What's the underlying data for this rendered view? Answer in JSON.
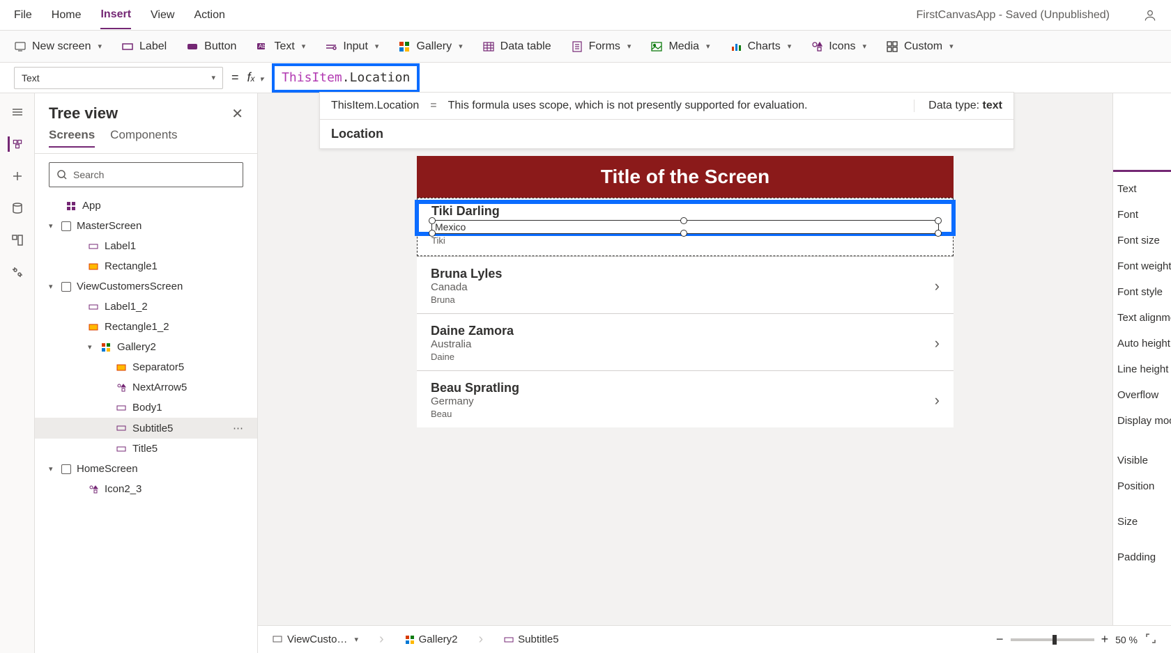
{
  "app": {
    "title": "FirstCanvasApp - Saved (Unpublished)"
  },
  "menubar": {
    "file": "File",
    "home": "Home",
    "insert": "Insert",
    "view": "View",
    "action": "Action"
  },
  "ribbon": {
    "new_screen": "New screen",
    "label": "Label",
    "button": "Button",
    "text": "Text",
    "input": "Input",
    "gallery": "Gallery",
    "data_table": "Data table",
    "forms": "Forms",
    "media": "Media",
    "charts": "Charts",
    "icons": "Icons",
    "custom": "Custom"
  },
  "formula": {
    "prop_selector": "Text",
    "ident": "ThisItem",
    "member": ".Location",
    "info_left": "ThisItem.Location",
    "eq": "=",
    "info_msg": "This formula uses scope, which is not presently supported for evaluation.",
    "datatype_label": "Data type:",
    "datatype_value": "text",
    "location": "Location"
  },
  "tree": {
    "title": "Tree view",
    "tab_screens": "Screens",
    "tab_components": "Components",
    "search_placeholder": "Search",
    "app": "App",
    "master_screen": "MasterScreen",
    "label1": "Label1",
    "rectangle1": "Rectangle1",
    "view_customers": "ViewCustomersScreen",
    "label1_2": "Label1_2",
    "rectangle1_2": "Rectangle1_2",
    "gallery2": "Gallery2",
    "separator5": "Separator5",
    "nextarrow5": "NextArrow5",
    "body1": "Body1",
    "subtitle5": "Subtitle5",
    "title5": "Title5",
    "home_screen": "HomeScreen",
    "icon2_3": "Icon2_3"
  },
  "canvas": {
    "header": "Title of the Screen",
    "items": [
      {
        "name": "Tiki Darling",
        "location": "Mexico",
        "body": "Tiki"
      },
      {
        "name": "Bruna  Lyles",
        "location": "Canada",
        "body": "Bruna"
      },
      {
        "name": "Daine  Zamora",
        "location": "Australia",
        "body": "Daine"
      },
      {
        "name": "Beau  Spratling",
        "location": "Germany",
        "body": "Beau"
      }
    ]
  },
  "props": {
    "text": "Text",
    "font": "Font",
    "font_size": "Font size",
    "font_weight": "Font weight",
    "font_style": "Font style",
    "text_align": "Text alignme",
    "auto_height": "Auto height",
    "line_height": "Line height",
    "overflow": "Overflow",
    "display_mode": "Display moc",
    "visible": "Visible",
    "position": "Position",
    "size": "Size",
    "padding": "Padding"
  },
  "status": {
    "crumb1": "ViewCusto…",
    "crumb2": "Gallery2",
    "crumb3": "Subtitle5",
    "zoom_pct": "50",
    "pct": "%",
    "minus": "−",
    "plus": "+"
  }
}
